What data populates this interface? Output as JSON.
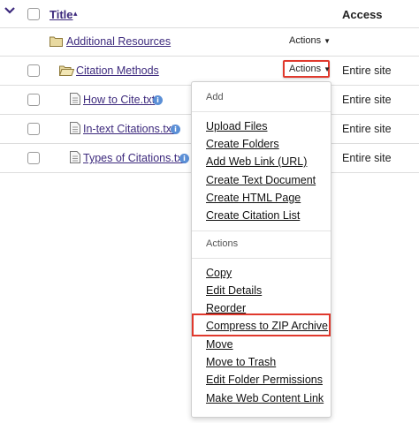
{
  "header": {
    "title_label": "Title",
    "sort_indicator": "▴",
    "access_label": "Access"
  },
  "rows": [
    {
      "name": "Additional Resources",
      "actions_label": "Actions",
      "access": ""
    },
    {
      "name": "Citation Methods",
      "actions_label": "Actions",
      "access": "Entire site"
    },
    {
      "name": "How to Cite.txt",
      "access": "Entire site"
    },
    {
      "name": "In-text Citations.txt",
      "access": "Entire site"
    },
    {
      "name": "Types of Citations.txt",
      "access": "Entire site"
    }
  ],
  "menu": {
    "add_heading": "Add",
    "add_items": [
      "Upload Files",
      "Create Folders",
      "Add Web Link (URL)",
      "Create Text Document",
      "Create HTML Page",
      "Create Citation List"
    ],
    "actions_heading": "Actions",
    "action_items": [
      "Copy",
      "Edit Details",
      "Reorder",
      "Compress to ZIP Archive",
      "Move",
      "Move to Trash",
      "Edit Folder Permissions",
      "Make Web Content Link"
    ]
  },
  "colors": {
    "link": "#3d2a7d",
    "highlight": "#e0392d",
    "folder": "#e8d9a0",
    "info": "#5b8fd6"
  }
}
